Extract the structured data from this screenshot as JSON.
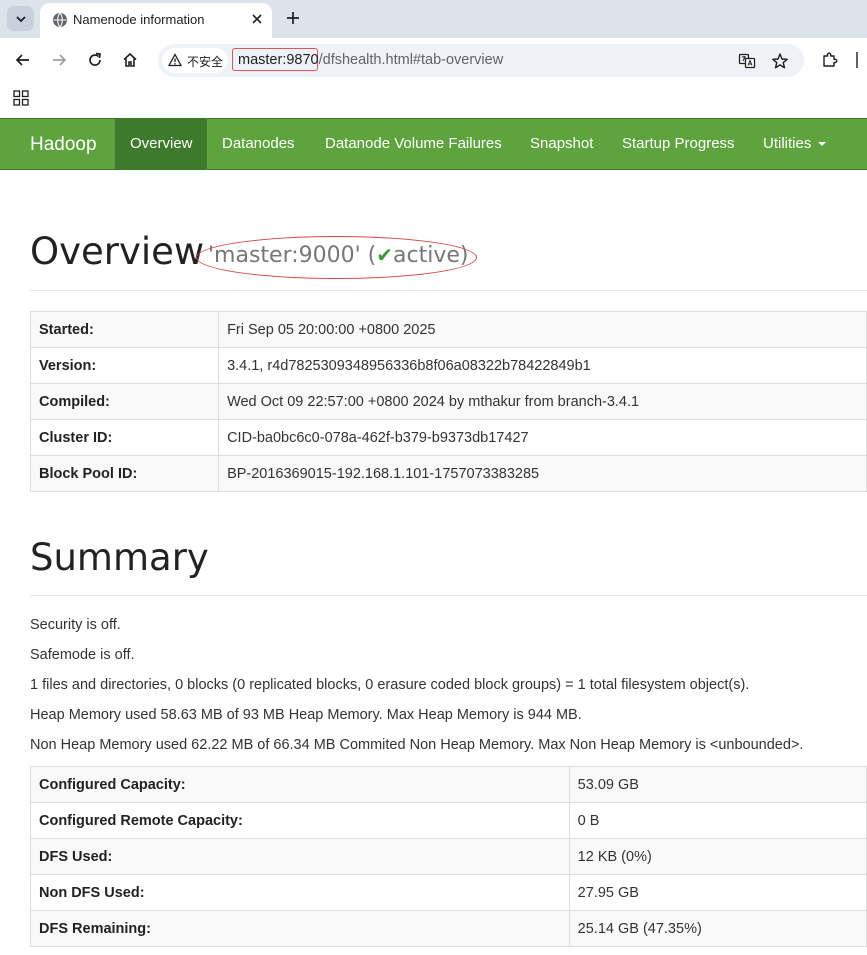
{
  "browser": {
    "tab_title": "Namenode information",
    "security_label": "不安全",
    "url_host": "master:9870",
    "url_path": "/dfshealth.html#tab-overview"
  },
  "navbar": {
    "brand": "Hadoop",
    "items": [
      {
        "label": "Overview",
        "active": true
      },
      {
        "label": "Datanodes"
      },
      {
        "label": "Datanode Volume Failures"
      },
      {
        "label": "Snapshot"
      },
      {
        "label": "Startup Progress"
      },
      {
        "label": "Utilities"
      }
    ]
  },
  "overview": {
    "heading": "Overview",
    "subtitle_pre": "'master:9000' (",
    "subtitle_check": "✔",
    "subtitle_status": "active",
    "subtitle_post": ")",
    "rows": [
      {
        "key": "Started:",
        "value": "Fri Sep 05 20:00:00 +0800 2025"
      },
      {
        "key": "Version:",
        "value": "3.4.1, r4d7825309348956336b8f06a08322b78422849b1"
      },
      {
        "key": "Compiled:",
        "value": "Wed Oct 09 22:57:00 +0800 2024 by mthakur from branch-3.4.1"
      },
      {
        "key": "Cluster ID:",
        "value": "CID-ba0bc6c0-078a-462f-b379-b9373db17427"
      },
      {
        "key": "Block Pool ID:",
        "value": "BP-2016369015-192.168.1.101-1757073383285"
      }
    ]
  },
  "summary": {
    "heading": "Summary",
    "lines": [
      "Security is off.",
      "Safemode is off.",
      "1 files and directories, 0 blocks (0 replicated blocks, 0 erasure coded block groups) = 1 total filesystem object(s).",
      "Heap Memory used 58.63 MB of 93 MB Heap Memory. Max Heap Memory is 944 MB.",
      "Non Heap Memory used 62.22 MB of 66.34 MB Commited Non Heap Memory. Max Non Heap Memory is <unbounded>."
    ],
    "rows": [
      {
        "key": "Configured Capacity:",
        "value": "53.09 GB"
      },
      {
        "key": "Configured Remote Capacity:",
        "value": "0 B"
      },
      {
        "key": "DFS Used:",
        "value": "12 KB (0%)"
      },
      {
        "key": "Non DFS Used:",
        "value": "27.95 GB"
      },
      {
        "key": "DFS Remaining:",
        "value": "25.14 GB (47.35%)"
      }
    ]
  },
  "colors": {
    "navbar": "#5fa33e",
    "navbar_active": "#3e7a2b",
    "annotation": "#d84545"
  }
}
